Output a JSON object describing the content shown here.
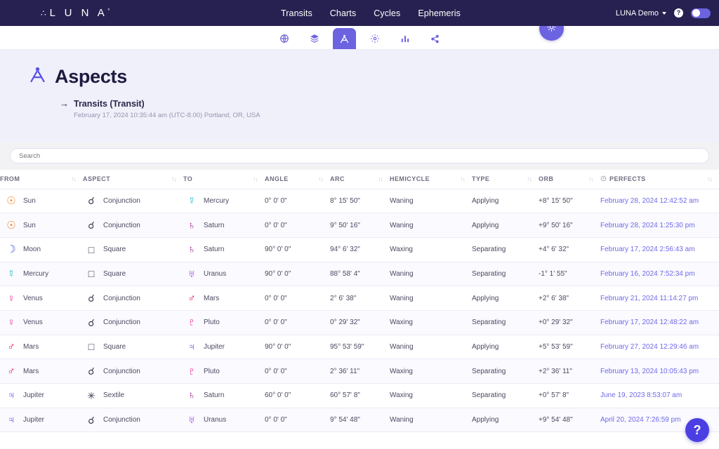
{
  "brand": {
    "mark": "∴",
    "name": "L U N A",
    "superscript": "°"
  },
  "topnav": {
    "items": [
      {
        "label": "Transits"
      },
      {
        "label": "Charts"
      },
      {
        "label": "Cycles"
      },
      {
        "label": "Ephemeris"
      }
    ],
    "user_label": "LUNA Demo",
    "help_icon": "question-mark-icon",
    "theme_toggle": "theme-toggle"
  },
  "subnav": {
    "items": [
      {
        "name": "globe-icon",
        "active": false
      },
      {
        "name": "layers-icon",
        "active": false
      },
      {
        "name": "aspects-icon",
        "active": true
      },
      {
        "name": "gear-icon",
        "active": false
      },
      {
        "name": "chart-bars-icon",
        "active": false
      },
      {
        "name": "share-icon",
        "active": false
      }
    ],
    "float_button": "sun-icon"
  },
  "hero": {
    "icon": "aspects-icon",
    "title": "Aspects",
    "arrow": "→",
    "subject": "Transits (Transit)",
    "datetime": "February 17, 2024 10:35:44 am (UTC-8.00) Portland, OR, USA"
  },
  "search": {
    "placeholder": "Search",
    "value": ""
  },
  "table": {
    "sort_icon": "↑↓",
    "clock_icon": "clock-icon",
    "columns": [
      {
        "key": "from",
        "label": "FROM"
      },
      {
        "key": "aspect",
        "label": "ASPECT"
      },
      {
        "key": "to",
        "label": "TO"
      },
      {
        "key": "angle",
        "label": "ANGLE"
      },
      {
        "key": "arc",
        "label": "ARC"
      },
      {
        "key": "hemicycle",
        "label": "HEMICYCLE"
      },
      {
        "key": "type",
        "label": "TYPE"
      },
      {
        "key": "orb",
        "label": "ORB"
      },
      {
        "key": "perfects",
        "label": "PERFECTS"
      }
    ],
    "rows": [
      {
        "from": "Sun",
        "from_glyph": "☉",
        "from_color": "#f5831f",
        "aspect": "Conjunction",
        "aspect_glyph": "☌",
        "to": "Mercury",
        "to_glyph": "☿",
        "to_color": "#1cb5c9",
        "angle": "0° 0' 0\"",
        "arc": "8° 15' 50\"",
        "hemicycle": "Waning",
        "type": "Applying",
        "orb": "+8° 15' 50\"",
        "perfects": "February 28, 2024 12:42:52 am"
      },
      {
        "from": "Sun",
        "from_glyph": "☉",
        "from_color": "#f5831f",
        "aspect": "Conjunction",
        "aspect_glyph": "☌",
        "to": "Saturn",
        "to_glyph": "♄",
        "to_color": "#a2208c",
        "angle": "0° 0' 0\"",
        "arc": "9° 50' 16\"",
        "hemicycle": "Waning",
        "type": "Applying",
        "orb": "+9° 50' 16\"",
        "perfects": "February 28, 2024 1:25:30 pm"
      },
      {
        "from": "Moon",
        "from_glyph": "☽",
        "from_color": "#4b55d6",
        "aspect": "Square",
        "aspect_glyph": "□",
        "to": "Saturn",
        "to_glyph": "♄",
        "to_color": "#a2208c",
        "angle": "90° 0' 0\"",
        "arc": "94° 6' 32\"",
        "hemicycle": "Waxing",
        "type": "Separating",
        "orb": "+4° 6' 32\"",
        "perfects": "February 17, 2024 2:56:43 am"
      },
      {
        "from": "Mercury",
        "from_glyph": "☿",
        "from_color": "#1cb5c9",
        "aspect": "Square",
        "aspect_glyph": "□",
        "to": "Uranus",
        "to_glyph": "♅",
        "to_color": "#9b3fe8",
        "angle": "90° 0' 0\"",
        "arc": "88° 58' 4\"",
        "hemicycle": "Waning",
        "type": "Separating",
        "orb": "-1° 1' 55\"",
        "perfects": "February 16, 2024 7:52:34 pm"
      },
      {
        "from": "Venus",
        "from_glyph": "♀",
        "from_color": "#e8339b",
        "aspect": "Conjunction",
        "aspect_glyph": "☌",
        "to": "Mars",
        "to_glyph": "♂",
        "to_color": "#e8135c",
        "angle": "0° 0' 0\"",
        "arc": "2° 6' 38\"",
        "hemicycle": "Waning",
        "type": "Applying",
        "orb": "+2° 6' 38\"",
        "perfects": "February 21, 2024 11:14:27 pm"
      },
      {
        "from": "Venus",
        "from_glyph": "♀",
        "from_color": "#e8339b",
        "aspect": "Conjunction",
        "aspect_glyph": "☌",
        "to": "Pluto",
        "to_glyph": "♇",
        "to_color": "#e8137f",
        "angle": "0° 0' 0\"",
        "arc": "0° 29' 32\"",
        "hemicycle": "Waxing",
        "type": "Separating",
        "orb": "+0° 29' 32\"",
        "perfects": "February 17, 2024 12:48:22 am"
      },
      {
        "from": "Mars",
        "from_glyph": "♂",
        "from_color": "#e8135c",
        "aspect": "Square",
        "aspect_glyph": "□",
        "to": "Jupiter",
        "to_glyph": "♃",
        "to_color": "#5b50e8",
        "angle": "90° 0' 0\"",
        "arc": "95° 53' 59\"",
        "hemicycle": "Waning",
        "type": "Applying",
        "orb": "+5° 53' 59\"",
        "perfects": "February 27, 2024 12:29:46 am"
      },
      {
        "from": "Mars",
        "from_glyph": "♂",
        "from_color": "#e8135c",
        "aspect": "Conjunction",
        "aspect_glyph": "☌",
        "to": "Pluto",
        "to_glyph": "♇",
        "to_color": "#e8137f",
        "angle": "0° 0' 0\"",
        "arc": "2° 36' 11\"",
        "hemicycle": "Waxing",
        "type": "Separating",
        "orb": "+2° 36' 11\"",
        "perfects": "February 13, 2024 10:05:43 pm"
      },
      {
        "from": "Jupiter",
        "from_glyph": "♃",
        "from_color": "#5b50e8",
        "aspect": "Sextile",
        "aspect_glyph": "✳",
        "to": "Saturn",
        "to_glyph": "♄",
        "to_color": "#a2208c",
        "angle": "60° 0' 0\"",
        "arc": "60° 57' 8\"",
        "hemicycle": "Waxing",
        "type": "Separating",
        "orb": "+0° 57' 8\"",
        "perfects": "June 19, 2023 8:53:07 am"
      },
      {
        "from": "Jupiter",
        "from_glyph": "♃",
        "from_color": "#5b50e8",
        "aspect": "Conjunction",
        "aspect_glyph": "☌",
        "to": "Uranus",
        "to_glyph": "♅",
        "to_color": "#9b3fe8",
        "angle": "0° 0' 0\"",
        "arc": "9° 54' 48\"",
        "hemicycle": "Waning",
        "type": "Applying",
        "orb": "+9° 54' 48\"",
        "perfects": "April 20, 2024 7:26:59 pm"
      }
    ]
  },
  "help_fab": {
    "label": "?"
  },
  "colors": {
    "brand_dark": "#262150",
    "accent": "#6c63e0",
    "hero_bg": "#f0f0fb",
    "link": "#7069e8"
  }
}
